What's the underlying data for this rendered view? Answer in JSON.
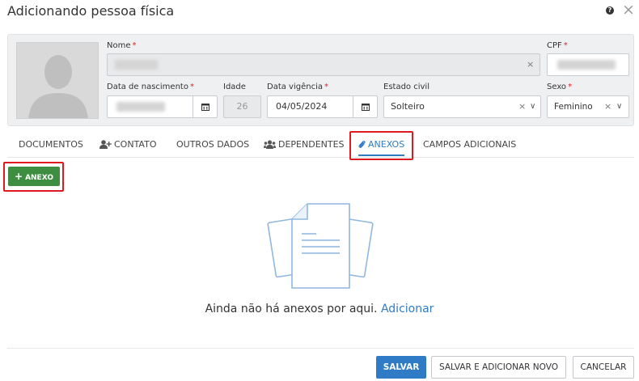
{
  "dialog": {
    "title": "Adicionando pessoa física",
    "help_label": "?",
    "close_label": "×"
  },
  "form": {
    "nome": {
      "label": "Nome",
      "required": "*",
      "clear": "×"
    },
    "cpf": {
      "label": "CPF",
      "required": "*"
    },
    "data_nascimento": {
      "label": "Data de nascimento",
      "required": "*"
    },
    "idade": {
      "label": "Idade",
      "value": "26"
    },
    "data_vigencia": {
      "label": "Data vigência",
      "required": "*",
      "value": "04/05/2024"
    },
    "estado_civil": {
      "label": "Estado civil",
      "value": "Solteiro",
      "clear": "×",
      "chevron": "∨"
    },
    "sexo": {
      "label": "Sexo",
      "required": "*",
      "value": "Feminino",
      "clear": "×",
      "chevron": "∨"
    }
  },
  "tabs": [
    {
      "label": "DOCUMENTOS",
      "icon": ""
    },
    {
      "label": "CONTATO",
      "icon": "user-plus-icon"
    },
    {
      "label": "OUTROS DADOS",
      "icon": ""
    },
    {
      "label": "DEPENDENTES",
      "icon": "users-icon"
    },
    {
      "label": "ANEXOS",
      "icon": "paperclip-icon",
      "active": true
    },
    {
      "label": "CAMPOS ADICIONAIS",
      "icon": ""
    }
  ],
  "attachments": {
    "add_button_icon": "+",
    "add_button_label": "ANEXO",
    "empty_message": "Ainda não há anexos por aqui.",
    "empty_link": "Adicionar"
  },
  "footer": {
    "save_label": "SALVAR",
    "save_add_label": "SALVAR E ADICIONAR NOVO",
    "cancel_label": "CANCELAR"
  },
  "colors": {
    "primary": "#2f7bc6",
    "success": "#3e8e41",
    "highlight": "#e0191f",
    "required": "#e02020"
  }
}
